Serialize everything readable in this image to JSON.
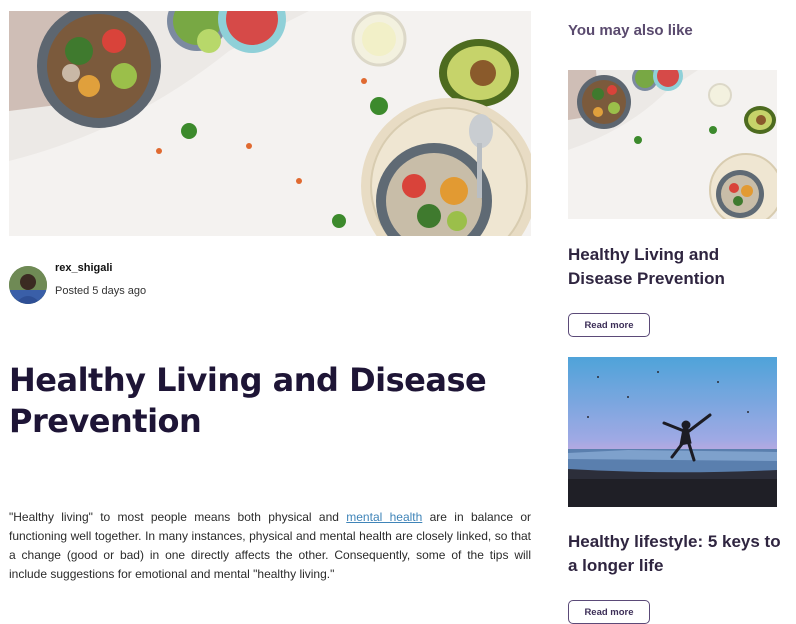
{
  "article": {
    "author": "rex_shigali",
    "posted": "Posted 5 days ago",
    "title": "Healthy Living and Disease Prevention",
    "body_before": "\"Healthy living\" to most people means both physical and ",
    "body_link": "mental health",
    "body_after": " are in balance or functioning well together. In many instances, physical and mental health are closely linked, so that a change (good or bad) in one directly affects the other. Consequently, some of the tips will include suggestions for emotional and mental \"healthy living.\""
  },
  "sidebar": {
    "heading": "You may also like",
    "cards": [
      {
        "title": "Healthy Living and Disease Prevention",
        "button": "Read more"
      },
      {
        "title": "Healthy lifestyle: 5 keys to a longer life",
        "button": "Read more"
      }
    ]
  },
  "colors": {
    "title": "#1e1536",
    "accent": "#5b4a78",
    "link": "#3f84b8"
  }
}
